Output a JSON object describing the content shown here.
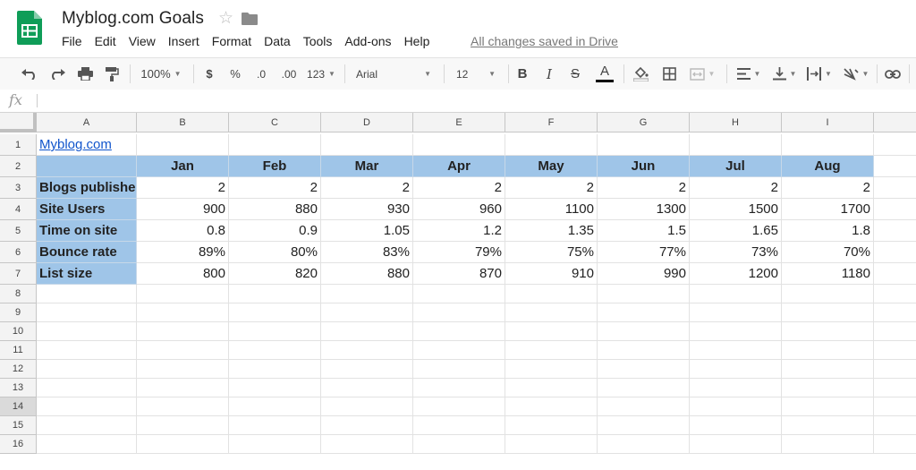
{
  "app": {
    "doc_title": "Myblog.com Goals",
    "saved_status": "All changes saved in Drive",
    "menu": [
      "File",
      "Edit",
      "View",
      "Insert",
      "Format",
      "Data",
      "Tools",
      "Add-ons",
      "Help"
    ]
  },
  "toolbar": {
    "zoom": "100%",
    "currency": "$",
    "percent": "%",
    "dec_decrease": ".0",
    "dec_increase": ".00",
    "more_formats": "123",
    "font": "Arial",
    "font_size": "12",
    "bold": "B",
    "italic": "I",
    "strike": "S",
    "text_color": "A"
  },
  "formula_bar": {
    "label": "fx",
    "value": ""
  },
  "colors": {
    "header_fill": "#9fc5e8",
    "link": "#1155cc",
    "brand": "#0f9d58"
  },
  "sheet": {
    "columns": [
      "A",
      "B",
      "C",
      "D",
      "E",
      "F",
      "G",
      "H",
      "I"
    ],
    "rows": [
      "1",
      "2",
      "3",
      "4",
      "5",
      "6",
      "7",
      "8",
      "9",
      "10",
      "11",
      "12",
      "13",
      "14",
      "15",
      "16"
    ],
    "selected_row": "14",
    "link": "Myblog.com",
    "months": [
      "Jan",
      "Feb",
      "Mar",
      "Apr",
      "May",
      "Jun",
      "Jul",
      "Aug"
    ],
    "data": [
      {
        "label": "Blogs published",
        "values": [
          "2",
          "2",
          "2",
          "2",
          "2",
          "2",
          "2",
          "2"
        ]
      },
      {
        "label": "Site Users",
        "values": [
          "900",
          "880",
          "930",
          "960",
          "1100",
          "1300",
          "1500",
          "1700"
        ]
      },
      {
        "label": "Time on site",
        "values": [
          "0.8",
          "0.9",
          "1.05",
          "1.2",
          "1.35",
          "1.5",
          "1.65",
          "1.8"
        ]
      },
      {
        "label": "Bounce rate",
        "values": [
          "89%",
          "80%",
          "83%",
          "79%",
          "75%",
          "77%",
          "73%",
          "70%"
        ]
      },
      {
        "label": "List size",
        "values": [
          "800",
          "820",
          "880",
          "870",
          "910",
          "990",
          "1200",
          "1180"
        ]
      }
    ]
  }
}
